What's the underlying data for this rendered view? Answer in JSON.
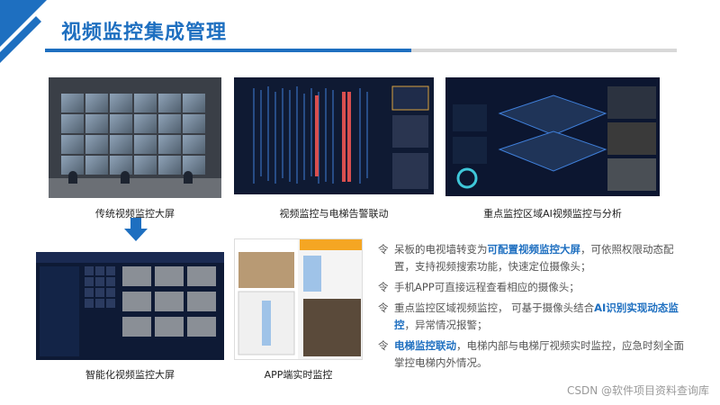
{
  "title": "视频监控集成管理",
  "images": {
    "traditional": {
      "caption": "传统视频监控大屏"
    },
    "elevator": {
      "caption": "视频监控与电梯告警联动"
    },
    "ai": {
      "caption": "重点监控区域AI视频监控与分析"
    },
    "smart": {
      "caption": "智能化视频监控大屏"
    },
    "app": {
      "caption": "APP端实时监控"
    }
  },
  "bullets": [
    {
      "mark": "令",
      "pre": "呆板的电视墙转变为",
      "hl": "可配置视频监控大屏",
      "post": "，可依照权限动态配置，支持视频搜索功能，快速定位摄像头；"
    },
    {
      "mark": "令",
      "pre": "手机APP可直接远程查看相应的摄像头；",
      "hl": "",
      "post": ""
    },
    {
      "mark": "令",
      "pre": "重点监控区域视频监控，  可基于摄像头结合",
      "hl": "AI识别实现动态监控",
      "post": "，异常情况报警；"
    },
    {
      "mark": "令",
      "pre": "",
      "hl": "电梯监控联动",
      "post": "，电梯内部与电梯厅视频实时监控，应急时刻全面掌控电梯内外情况。"
    }
  ],
  "watermark": "CSDN @软件项目资料查询库",
  "colors": {
    "accent": "#1e6fc0",
    "bar_gray": "#d8d8d8",
    "dark_screen": "#0f1a33"
  },
  "icons": {
    "arrow": "down-arrow-icon",
    "corner": "corner-decoration"
  }
}
